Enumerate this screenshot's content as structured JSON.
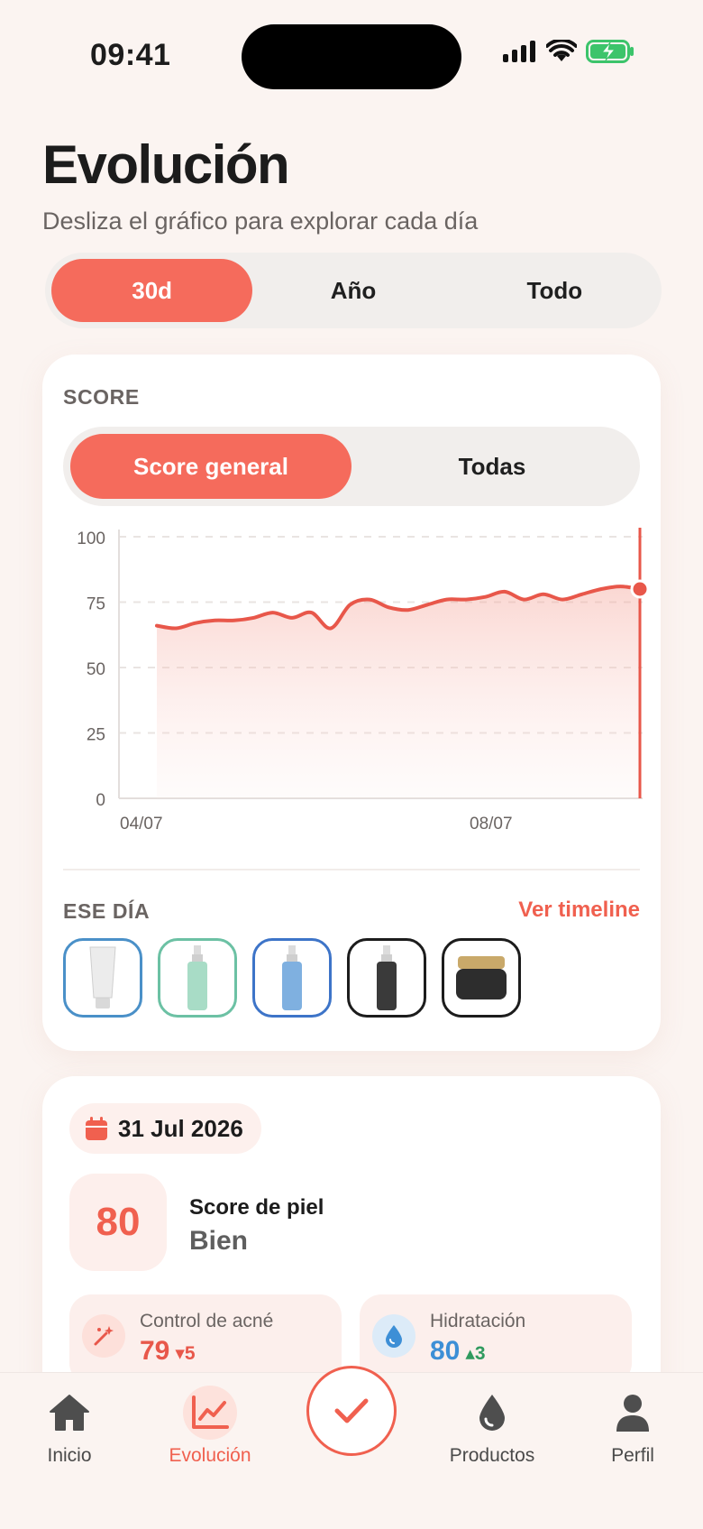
{
  "status": {
    "time": "09:41"
  },
  "header": {
    "title": "Evolución",
    "subtitle": "Desliza el gráfico para explorar cada día"
  },
  "range_tabs": [
    {
      "label": "30d",
      "active": true
    },
    {
      "label": "Año",
      "active": false
    },
    {
      "label": "Todo",
      "active": false
    }
  ],
  "chart_card": {
    "section_label": "SCORE",
    "score_tabs": [
      {
        "label": "Score general",
        "active": true
      },
      {
        "label": "Todas",
        "active": false
      }
    ],
    "chart_data": {
      "type": "area",
      "x_tick_labels": [
        "04/07",
        "08/07"
      ],
      "y_ticks": [
        100,
        75,
        50,
        25,
        0
      ],
      "ylim": [
        0,
        100
      ],
      "grid": "horizontal-dashed",
      "series": [
        {
          "values": [
            66,
            65,
            67,
            68,
            68,
            69,
            71,
            69,
            71,
            65,
            74,
            76,
            73,
            72,
            74,
            76,
            76,
            77,
            79,
            76,
            78,
            76,
            78,
            80,
            81,
            80
          ]
        }
      ],
      "selected_value": 80,
      "color": "#e8574a"
    },
    "day_section_label": "ESE DÍA",
    "timeline_link": "Ver timeline",
    "products": [
      {
        "icon": "tube-icon",
        "border": "#4a90c8"
      },
      {
        "icon": "pump-bottle-icon",
        "border": "#6cc1a4"
      },
      {
        "icon": "pump-bottle-icon",
        "border": "#3d74c8"
      },
      {
        "icon": "pump-bottle-icon",
        "border": "#1c1c1c"
      },
      {
        "icon": "jar-icon",
        "border": "#1c1c1c"
      }
    ]
  },
  "detail_card": {
    "date": "31 Jul 2026",
    "score_value": "80",
    "score_title": "Score de piel",
    "score_status": "Bien",
    "metrics": [
      {
        "name": "Control de acné",
        "value": "79",
        "delta": "5",
        "direction": "down",
        "color": "#e8574a"
      },
      {
        "name": "Hidratación",
        "value": "80",
        "delta": "3",
        "direction": "up",
        "color": "#3d8fd6",
        "delta_color": "#2f9a5e"
      }
    ]
  },
  "tabbar": [
    {
      "label": "Inicio",
      "icon": "home-icon",
      "active": false
    },
    {
      "label": "Evolución",
      "icon": "chart-icon",
      "active": true
    },
    {
      "label": "Productos",
      "icon": "drop-icon",
      "active": false
    },
    {
      "label": "Perfil",
      "icon": "user-icon",
      "active": false
    }
  ],
  "colors": {
    "accent": "#f56b5c",
    "background": "#fbf4f1"
  }
}
